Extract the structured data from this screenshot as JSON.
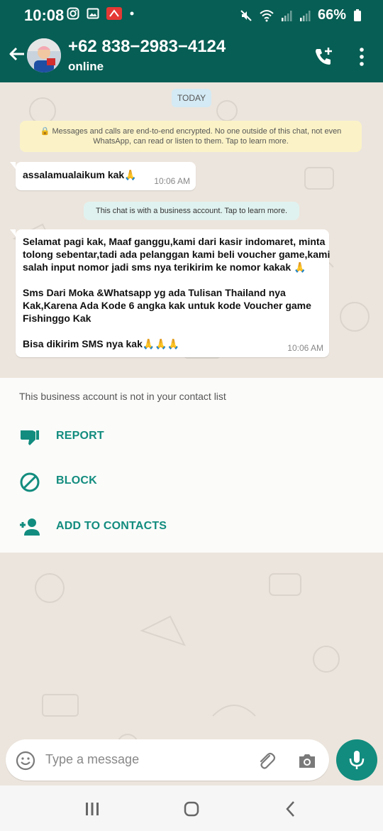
{
  "status": {
    "time": "10:08",
    "battery": "66%",
    "icons": [
      "instagram-icon",
      "gallery-icon",
      "app-icon",
      "dot-icon",
      "mute-icon",
      "wifi-icon",
      "signal-icon",
      "signal-icon",
      "battery-icon"
    ]
  },
  "header": {
    "contact": "+62 838−2983−4124",
    "status": "online"
  },
  "chat": {
    "date_chip": "TODAY",
    "encryption_notice": "🔒 Messages and calls are end-to-end encrypted. No one outside of this chat, not even WhatsApp, can read or listen to them. Tap to learn more.",
    "messages": [
      {
        "lines": [
          "assalamualaikum kak🙏"
        ],
        "time": "10:06 AM"
      },
      {
        "lines": [
          "Selamat pagi kak, Maaf ganggu,kami dari kasir indomaret, minta",
          "tolong sebentar,tadi ada pelanggan kami beli voucher game,kami",
          "salah input nomor jadi sms nya terikirim ke nomor kakak 🙏",
          "",
          "Sms Dari Moka &Whatsapp yg ada Tulisan Thailand nya",
          "Kak,Karena Ada Kode 6 angka kak untuk kode Voucher game",
          "Fishinggo Kak",
          "",
          " Bisa dikirim SMS nya kak🙏🙏🙏"
        ],
        "time": "10:06 AM"
      }
    ],
    "business_notice": "This chat is with a business account. Tap to learn more."
  },
  "panel": {
    "note": "This business account is not in your contact list",
    "actions": {
      "report": "REPORT",
      "block": "BLOCK",
      "add": "ADD TO CONTACTS"
    }
  },
  "composer": {
    "placeholder": "Type a message"
  },
  "colors": {
    "primary": "#075e54",
    "accent": "#128c7e",
    "background": "#ece5dd"
  }
}
